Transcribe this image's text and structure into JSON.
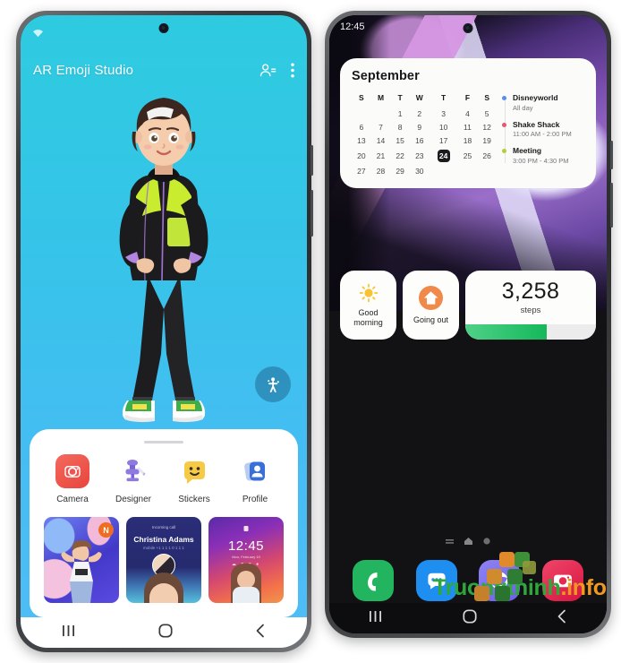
{
  "left_phone": {
    "app": {
      "title": "AR Emoji Studio",
      "header_icons": [
        {
          "name": "contacts-icon",
          "glyph": "person-list"
        },
        {
          "name": "overflow-menu-icon",
          "glyph": "three-dots-vertical"
        }
      ],
      "status_icons": [
        {
          "name": "wifi-icon"
        }
      ],
      "fab": {
        "name": "pose-icon",
        "label": "Pose"
      },
      "apps": [
        {
          "label": "Camera",
          "icon": "camera-icon",
          "color": "#ef5350"
        },
        {
          "label": "Designer",
          "icon": "designer-icon",
          "color": "#8f7ae0"
        },
        {
          "label": "Stickers",
          "icon": "stickers-icon",
          "color": "#f7ca45"
        },
        {
          "label": "Profile",
          "icon": "profile-icon",
          "color": "#3a6fd8"
        }
      ],
      "thumbnails": [
        {
          "name": "sticker-thumbnail",
          "badge": "N"
        },
        {
          "name": "call-screen-thumbnail",
          "caller": "Christina Adams",
          "sub": "Incoming call",
          "meta": "mobile  +1 1 1 1 0 1 1 1"
        },
        {
          "name": "lock-screen-thumbnail",
          "time": "12:45",
          "date": "Mon, February 19",
          "icons": "☁ ■ ■ ●"
        }
      ]
    },
    "navbar": [
      {
        "name": "recents-button",
        "glyph": "|||"
      },
      {
        "name": "home-button",
        "glyph": "circle"
      },
      {
        "name": "back-button",
        "glyph": "<"
      }
    ]
  },
  "right_phone": {
    "status": {
      "time": "12:45"
    },
    "calendar_widget": {
      "month": "September",
      "weekday_headers": [
        "S",
        "M",
        "T",
        "W",
        "T",
        "F",
        "S"
      ],
      "weeks": [
        [
          "",
          "",
          "1",
          "2",
          "3",
          "4",
          "5"
        ],
        [
          "6",
          "7",
          "8",
          "9",
          "10",
          "11",
          "12"
        ],
        [
          "13",
          "14",
          "15",
          "16",
          "17",
          "18",
          "19"
        ],
        [
          "20",
          "21",
          "22",
          "23",
          "24",
          "25",
          "26"
        ],
        [
          "27",
          "28",
          "29",
          "30",
          "",
          "",
          ""
        ]
      ],
      "today": "24",
      "events": [
        {
          "name": "Disneyworld",
          "time": "All day",
          "color": "#5b8def"
        },
        {
          "name": "Shake Shack",
          "time": "11:00 AM - 2:00 PM",
          "color": "#e8566c"
        },
        {
          "name": "Meeting",
          "time": "3:00 PM - 4:30 PM",
          "color": "#b4cf3a"
        }
      ]
    },
    "small_widgets": [
      {
        "name": "good-morning-widget",
        "label": "Good\nmorning",
        "label_line1": "Good",
        "label_line2": "morning",
        "icon": "sun-icon"
      },
      {
        "name": "going-out-widget",
        "label": "Going out",
        "icon": "home-icon",
        "icon_bg": "#f08a4b"
      }
    ],
    "steps_widget": {
      "count": "3,258",
      "unit": "steps",
      "progress_percent": 62,
      "bar_color": "#14b85a"
    },
    "page_indicators": [
      {
        "name": "page-indicator-list"
      },
      {
        "name": "page-indicator-home"
      },
      {
        "name": "page-indicator-dot"
      }
    ],
    "dock": [
      {
        "name": "phone-app-icon",
        "label": "Phone",
        "color": "#22b45f"
      },
      {
        "name": "messages-app-icon",
        "label": "Messages",
        "color": "#1e8ef0"
      },
      {
        "name": "internet-app-icon",
        "label": "Internet",
        "color": "#7b6ff0"
      },
      {
        "name": "camera-app-icon",
        "label": "Camera",
        "color": "#e8294f"
      }
    ],
    "navbar": [
      {
        "name": "recents-button",
        "glyph": "|||"
      },
      {
        "name": "home-button",
        "glyph": "circle"
      },
      {
        "name": "back-button",
        "glyph": "<"
      }
    ]
  },
  "watermark": {
    "text_primary": "Truongthinh",
    "text_secondary": ".info",
    "color_primary": "#2fa83b",
    "color_secondary": "#f0991e"
  }
}
